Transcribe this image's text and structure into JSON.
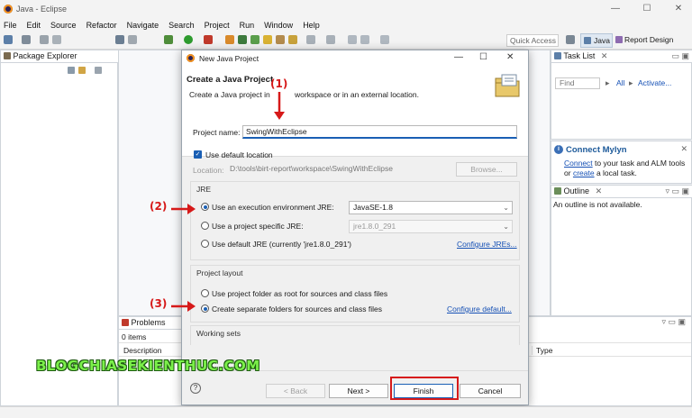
{
  "window": {
    "title": "Java - Eclipse",
    "minimize": "—",
    "maximize": "☐",
    "close": "✕"
  },
  "menu": [
    "File",
    "Edit",
    "Source",
    "Refactor",
    "Navigate",
    "Search",
    "Project",
    "Run",
    "Window",
    "Help"
  ],
  "toolbar": {
    "quick_access": "Quick Access",
    "perspective_java": "Java",
    "perspective_report": "Report Design"
  },
  "package_explorer": {
    "title": "Package Explorer"
  },
  "task_list": {
    "title": "Task List",
    "find_placeholder": "Find",
    "all": "All",
    "activate": "Activate..."
  },
  "mylyn": {
    "title": "Connect Mylyn",
    "connect_link": "Connect",
    "line1_rest": "to your task and ALM tools",
    "line2_prefix": "or",
    "create_link": "create",
    "line2_rest": "a local task."
  },
  "outline": {
    "title": "Outline",
    "message": "An outline is not available."
  },
  "problems": {
    "title": "Problems",
    "count": "0 items",
    "col_description": "Description",
    "col_type": "Type"
  },
  "dialog": {
    "title": "New Java Project",
    "heading": "Create a Java Project",
    "subtitle_part1": "Create a Java project in",
    "subtitle_part2": "workspace or in an external location.",
    "project_name_label": "Project name:",
    "project_name_value": "SwingWithEclipse",
    "use_default_location": "Use default location",
    "location_label": "Location:",
    "location_value": "D:\\tools\\birt-report\\workspace\\SwingWithEclipse",
    "browse": "Browse...",
    "jre_group": "JRE",
    "jre_exec_env": "Use an execution environment JRE:",
    "jre_exec_env_value": "JavaSE-1.8",
    "jre_specific": "Use a project specific JRE:",
    "jre_specific_value": "jre1.8.0_291",
    "jre_default": "Use default JRE (currently 'jre1.8.0_291')",
    "configure_jres": "Configure JREs...",
    "layout_group": "Project layout",
    "layout_root": "Use project folder as root for sources and class files",
    "layout_separate": "Create separate folders for sources and class files",
    "configure_default": "Configure default...",
    "working_sets_group": "Working sets",
    "help": "?",
    "back": "< Back",
    "next": "Next >",
    "finish": "Finish",
    "cancel": "Cancel"
  },
  "annotations": {
    "a1": "(1)",
    "a2": "(2)",
    "a3": "(3)",
    "watermark": "BLOGCHIASEKIENTHUC.COM"
  },
  "colors": {
    "accent": "#1a5fb4",
    "annotation": "#d61919",
    "watermark": "#7bf04a"
  }
}
